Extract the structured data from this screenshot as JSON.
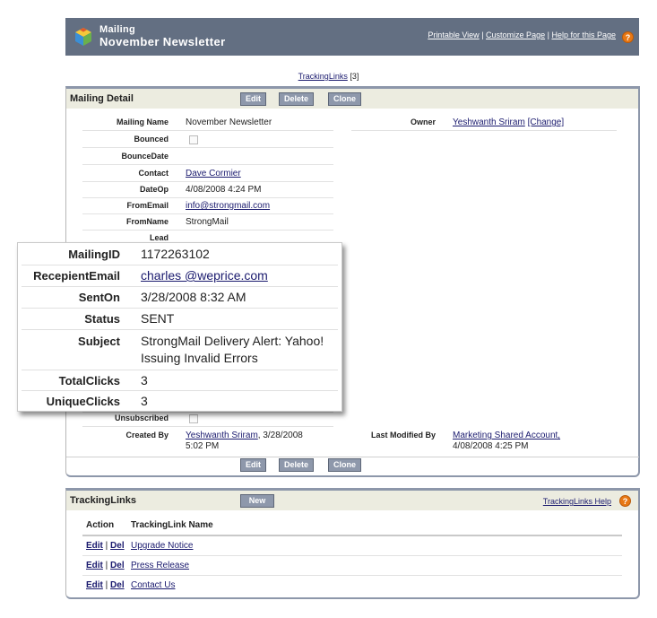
{
  "header": {
    "title_line1": "Mailing",
    "title_line2": "November Newsletter",
    "links": {
      "printable": "Printable View",
      "customize": "Customize Page",
      "help": "Help for this Page"
    },
    "help_icon": "?"
  },
  "tracking_links_anchor": {
    "label": "TrackingLinks",
    "count": "[3]"
  },
  "detail": {
    "title": "Mailing Detail",
    "buttons": {
      "edit": "Edit",
      "delete": "Delete",
      "clone": "Clone"
    },
    "fields": {
      "mailing_name": {
        "label": "Mailing Name",
        "value": "November Newsletter"
      },
      "bounced": {
        "label": "Bounced"
      },
      "bounce_date": {
        "label": "BounceDate",
        "value": ""
      },
      "contact": {
        "label": "Contact",
        "value": "Dave Cormier"
      },
      "date_op": {
        "label": "DateOp",
        "value": "4/08/2008 4:24 PM"
      },
      "from_email": {
        "label": "FromEmail",
        "value": "info@strongmail.com"
      },
      "from_name": {
        "label": "FromName",
        "value": "StrongMail"
      },
      "lead": {
        "label": "Lead",
        "value": ""
      },
      "unsubscribed": {
        "label": "Unsubscribed"
      },
      "created_by": {
        "label": "Created By",
        "user": "Yeshwanth Sriram",
        "date": ", 3/28/2008",
        "time": "5:02 PM"
      },
      "owner": {
        "label": "Owner",
        "user": "Yeshwanth Sriram",
        "change": "[Change]"
      },
      "last_modified_by": {
        "label": "Last Modified By",
        "user": "Marketing Shared Account,",
        "date": "4/08/2008 4:25 PM"
      }
    }
  },
  "callout": {
    "mailing_id": {
      "label": "MailingID",
      "value": "1172263102"
    },
    "recipient_email": {
      "label": "RecepientEmail",
      "value": "charles @weprice.com"
    },
    "sent_on": {
      "label": "SentOn",
      "value": "3/28/2008 8:32 AM"
    },
    "status": {
      "label": "Status",
      "value": "SENT"
    },
    "subject": {
      "label": "Subject",
      "line1": "StrongMail Delivery Alert: Yahoo!",
      "line2": "Issuing Invalid Errors"
    },
    "total_clicks": {
      "label": "TotalClicks",
      "value": "3"
    },
    "unique_clicks": {
      "label": "UniqueClicks",
      "value": "3"
    }
  },
  "tracking_links": {
    "title": "TrackingLinks",
    "new_button": "New",
    "help_link": "TrackingLinks Help",
    "columns": {
      "action": "Action",
      "name": "TrackingLink Name"
    },
    "edit_label": "Edit",
    "sep": " | ",
    "del_label": "Del",
    "rows": [
      {
        "name": "Upgrade Notice"
      },
      {
        "name": "Press Release"
      },
      {
        "name": "Contact Us"
      }
    ]
  },
  "colors": {
    "header_bg": "#636f82",
    "panel_head_bg": "#ecece0",
    "button_bg": "#8e98ab",
    "help_orange": "#e87814"
  }
}
